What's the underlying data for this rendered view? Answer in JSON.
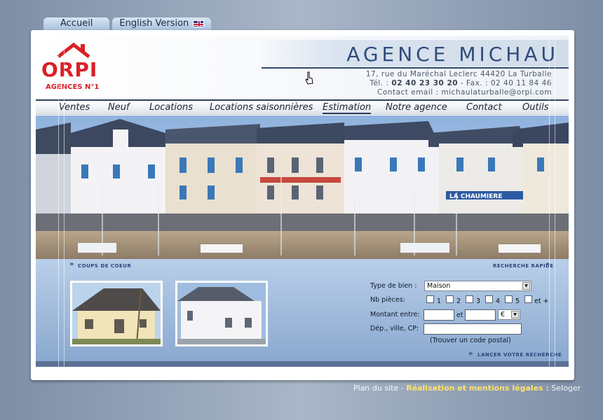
{
  "tabs": {
    "home": "Accueil",
    "english": "English Version"
  },
  "logo": {
    "word": "ORPI",
    "sub": "AGENCES N°1"
  },
  "header": {
    "agency": "AGENCE MICHAU",
    "address": "17, rue du Maréchal Leclerc 44420 La Turballe",
    "phone_prefix": "Tél. : ",
    "phone": "02 40 23 30 20",
    "fax": " - Fax. : 02 40 11 84 46",
    "email": "Contact email : michaulaturballe@orpi.com"
  },
  "nav": [
    "Ventes",
    "Neuf",
    "Locations",
    "Locations saisonnières",
    "Estimation",
    "Notre agence",
    "Contact",
    "Outils"
  ],
  "banner": {
    "shop_sign": "LA CHAUMIERE"
  },
  "featured": {
    "label": "COUPS DE COEUR"
  },
  "search": {
    "label": "RECHERCHE RAPIDE",
    "type_label": "Type de bien :",
    "type_value": "Maison",
    "rooms_label": "Nb pièces:",
    "rooms": [
      "1",
      "2",
      "3",
      "4",
      "5",
      "et +"
    ],
    "amount_label": "Montant entre:",
    "and": "et",
    "currency": "€",
    "place_label": "Dép., ville, CP:",
    "postal_hint": "(Trouver un code postal)",
    "submit": "LANCER VOTRE RECHERCHE"
  },
  "footer": {
    "sitemap": "Plan du site",
    "sep": " - ",
    "legal": "Réalisation et mentions légales :",
    "partner": " Seloger"
  },
  "colors": {
    "brand_red": "#d92027",
    "navy": "#2e4d7c",
    "footer_highlight": "#ffe16a"
  }
}
